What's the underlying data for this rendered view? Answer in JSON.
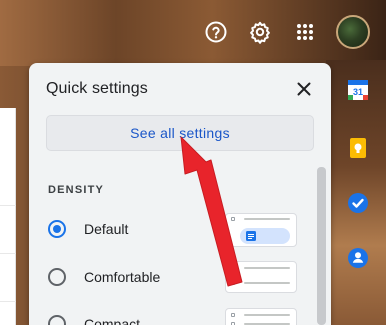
{
  "quick_settings": {
    "title": "Quick settings",
    "see_all_label": "See all settings",
    "density": {
      "section_title": "DENSITY",
      "options": [
        {
          "label": "Default",
          "selected": true
        },
        {
          "label": "Comfortable",
          "selected": false
        },
        {
          "label": "Compact",
          "selected": false
        }
      ]
    }
  },
  "header": {
    "icons": [
      "help-icon",
      "gear-icon",
      "apps-grid-icon",
      "account-avatar"
    ]
  },
  "side_panel": {
    "icons": [
      "google-calendar-icon",
      "google-keep-icon",
      "google-tasks-icon",
      "google-contacts-icon"
    ],
    "calendar_day": "31"
  },
  "colors": {
    "accent": "#1a73e8",
    "link": "#1a56c8",
    "annotation_arrow": "#e8242b",
    "panel_bg": "#f1f3f4"
  }
}
